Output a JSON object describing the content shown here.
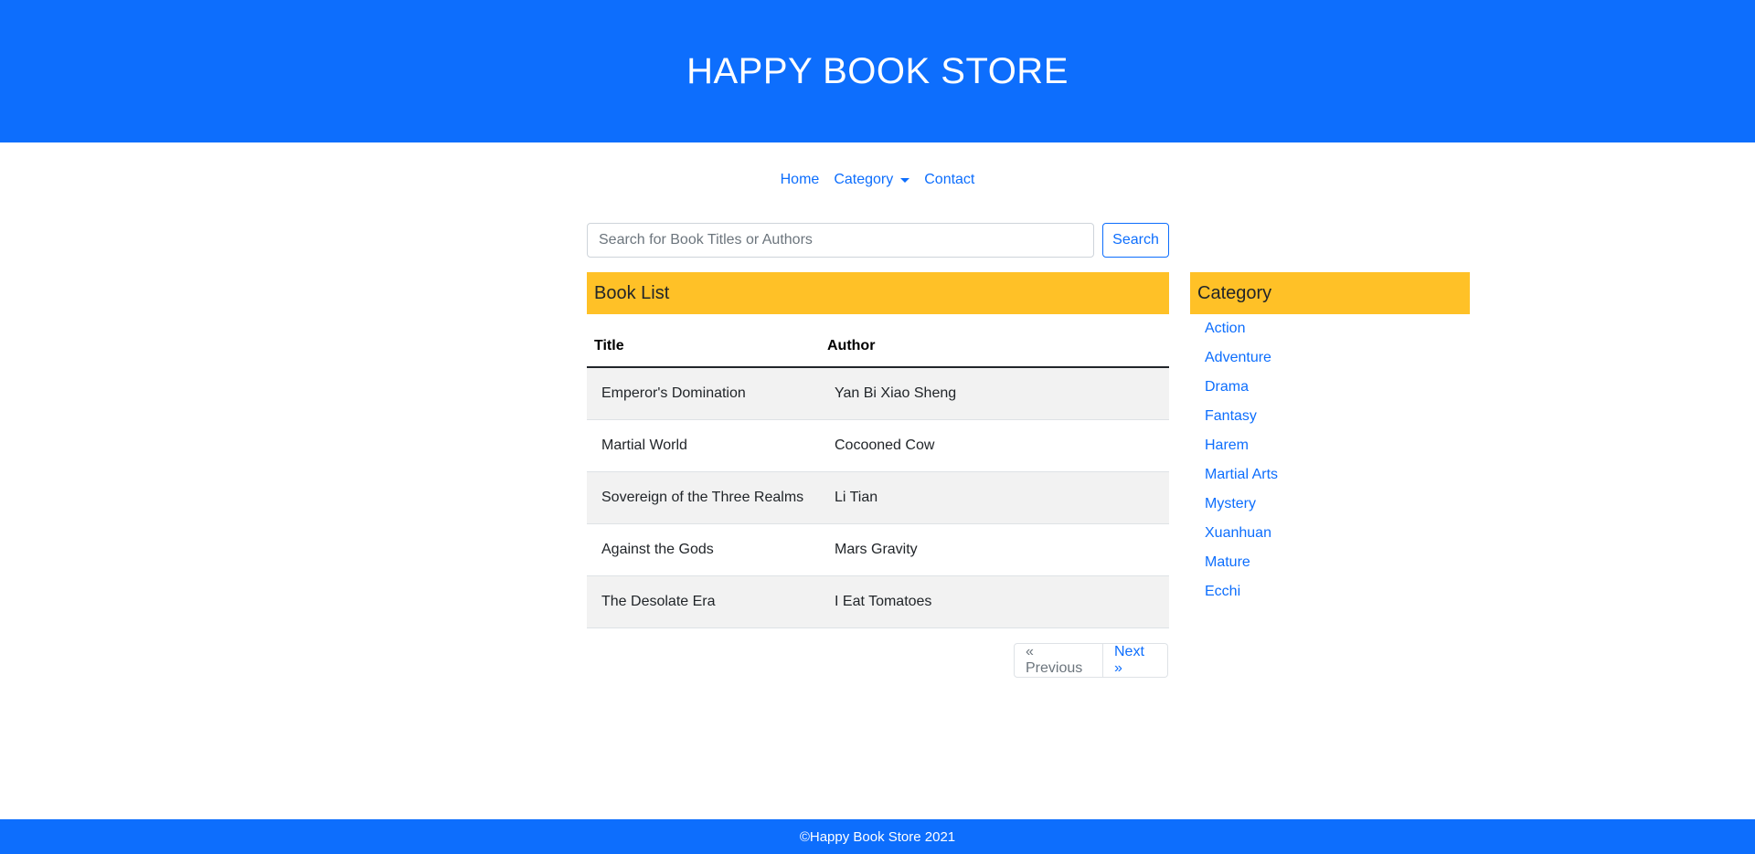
{
  "header": {
    "title": "HAPPY BOOK STORE"
  },
  "nav": {
    "home": "Home",
    "category": "Category",
    "contact": "Contact"
  },
  "search": {
    "placeholder": "Search for Book Titles or Authors",
    "value": "",
    "button_label": "Search"
  },
  "book_list": {
    "heading": "Book List",
    "columns": [
      "Title",
      "Author"
    ],
    "rows": [
      {
        "title": "Emperor's Domination",
        "author": "Yan Bi Xiao Sheng"
      },
      {
        "title": "Martial World",
        "author": "Cocooned Cow"
      },
      {
        "title": "Sovereign of the Three Realms",
        "author": "Li Tian"
      },
      {
        "title": "Against the Gods",
        "author": "Mars Gravity"
      },
      {
        "title": "The Desolate Era",
        "author": "I Eat Tomatoes"
      }
    ]
  },
  "pagination": {
    "previous": "« Previous",
    "next": "Next »"
  },
  "category_panel": {
    "heading": "Category",
    "items": [
      "Action",
      "Adventure",
      "Drama",
      "Fantasy",
      "Harem",
      "Martial Arts",
      "Mystery",
      "Xuanhuan",
      "Mature",
      "Ecchi"
    ]
  },
  "footer": {
    "text": "©Happy Book Store 2021"
  },
  "colors": {
    "primary": "#0d6efd",
    "panel_header": "#ffc127",
    "striped_row": "#f2f2f2"
  },
  "icons": {
    "category_dropdown": "caret-down-icon"
  }
}
